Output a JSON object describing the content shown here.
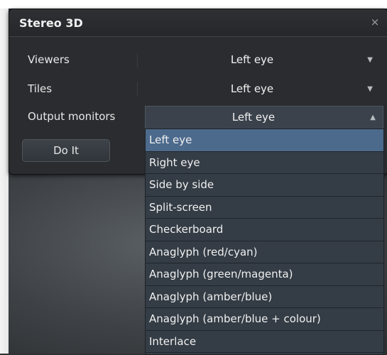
{
  "dialog": {
    "title": "Stereo 3D",
    "close_glyph": "×",
    "rows": [
      {
        "label": "Viewers",
        "value": "Left eye",
        "caret": "▼"
      },
      {
        "label": "Tiles",
        "value": "Left eye",
        "caret": "▼"
      },
      {
        "label": "Output monitors",
        "value": "Left eye",
        "caret": "▲"
      }
    ],
    "do_it_label": "Do It"
  },
  "dropdown": {
    "selected_index": 0,
    "options": [
      "Left eye",
      "Right eye",
      "Side by side",
      "Split-screen",
      "Checkerboard",
      "Anaglyph (red/cyan)",
      "Anaglyph (green/magenta)",
      "Anaglyph (amber/blue)",
      "Anaglyph (amber/blue + colour)",
      "Interlace"
    ]
  },
  "colors": {
    "selected_highlight": "#4c6a8c",
    "dialog_bg": "#2a2c2f",
    "dropdown_bg": "#343c45"
  }
}
